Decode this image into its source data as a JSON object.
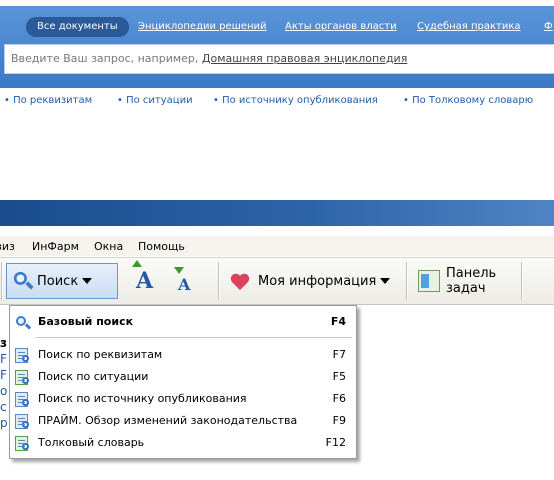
{
  "search_panel": {
    "tabs": [
      {
        "label": "Все документы",
        "active": true
      },
      {
        "label": "Энциклопедии решений",
        "active": false
      },
      {
        "label": "Акты органов власти",
        "active": false
      },
      {
        "label": "Судебная практика",
        "active": false
      },
      {
        "label": "Ф",
        "active": false
      }
    ],
    "input_placeholder": "Введите Ваш запрос, например, ",
    "input_example": "Домашняя правовая энциклопедия",
    "quick_links": [
      "• По реквизитам",
      "• По ситуации",
      "• По источнику опубликования",
      "• По Толковому словарю"
    ]
  },
  "menubar": {
    "items": [
      "зиз",
      "ИнФарм",
      "Окна",
      "Помощь"
    ]
  },
  "toolbar": {
    "search_label": "Поиск",
    "font_increase_glyph": "A",
    "font_decrease_glyph": "A",
    "my_info_label": "Моя информация",
    "task_panel_label_line1": "Панель",
    "task_panel_label_line2": "задач"
  },
  "left_sliver": [
    "з",
    "F",
    "F",
    "о",
    "с",
    "р"
  ],
  "dropdown": {
    "items": [
      {
        "label": "Базовый поиск",
        "key": "F4",
        "bold": true,
        "icon": "magnifier-icon"
      },
      {
        "label": "Поиск по реквизитам",
        "key": "F7",
        "bold": false,
        "icon": "search-requisites-icon"
      },
      {
        "label": "Поиск по ситуации",
        "key": "F5",
        "bold": false,
        "icon": "search-situation-icon"
      },
      {
        "label": "Поиск по источнику опубликования",
        "key": "F6",
        "bold": false,
        "icon": "search-source-icon"
      },
      {
        "label": "ПРАЙМ. Обзор изменений законодательства",
        "key": "F9",
        "bold": false,
        "icon": "prime-review-icon"
      },
      {
        "label": "Толковый словарь",
        "key": "F12",
        "bold": false,
        "icon": "dictionary-icon"
      }
    ]
  },
  "colors": {
    "panel_blue": "#3a79c8",
    "link_blue": "#1f5dad",
    "titlebar_blue": "#1a4c8e",
    "heart_red": "#d9435b",
    "arrow_green": "#3f9a2c"
  }
}
